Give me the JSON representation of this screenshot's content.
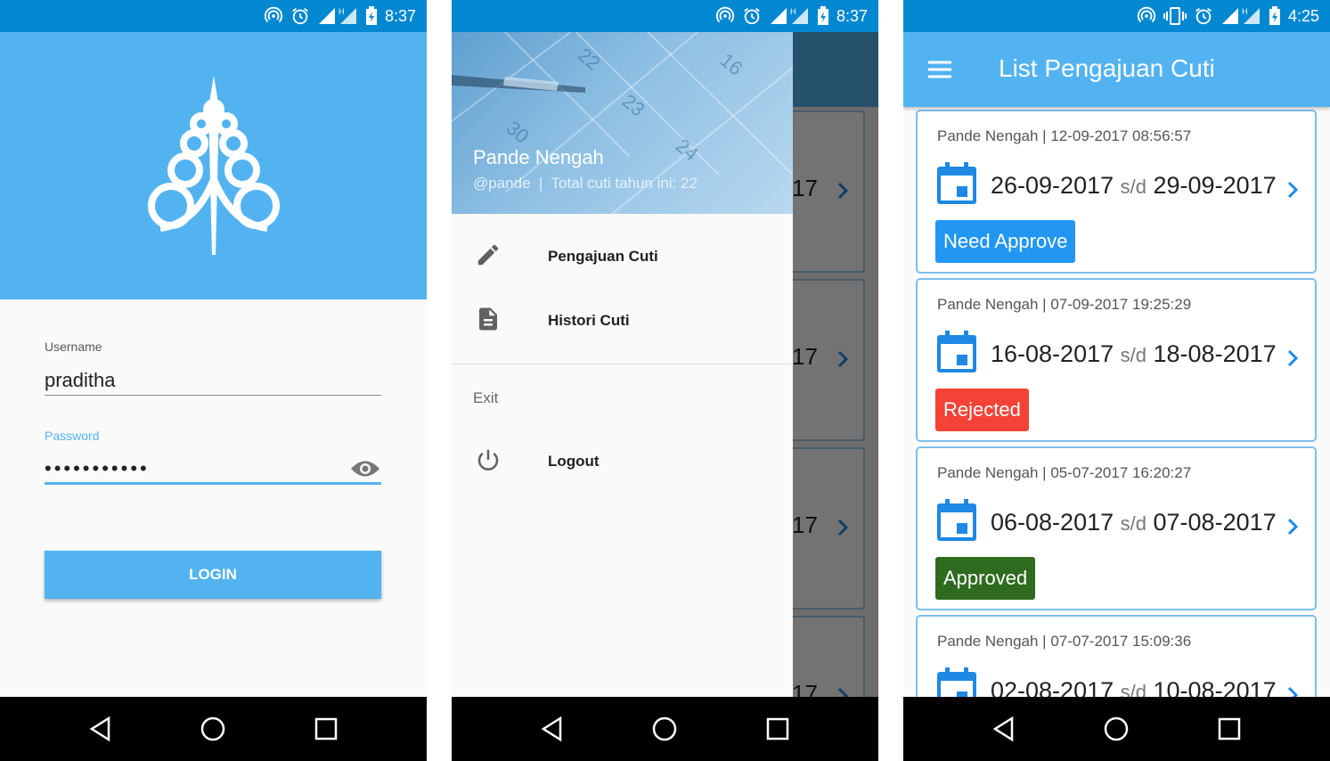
{
  "status_bar_1": {
    "time": "8:37"
  },
  "status_bar_2": {
    "time": "8:37"
  },
  "status_bar_3": {
    "time": "4:25"
  },
  "login": {
    "username_label": "Username",
    "username_value": "praditha",
    "password_label": "Password",
    "password_value": "•••••••••••",
    "login_label": "LOGIN"
  },
  "drawer": {
    "name": "Pande Nengah",
    "subtitle": "@pande  |  Total cuti tahun ini: 22",
    "items": [
      {
        "label": "Pengajuan Cuti",
        "icon": "pencil-icon"
      },
      {
        "label": "Histori Cuti",
        "icon": "document-icon"
      }
    ],
    "section_label": "Exit",
    "logout_label": "Logout",
    "behind_text": "17"
  },
  "list": {
    "title": "List Pengajuan Cuti",
    "separator": "s/d",
    "cards": [
      {
        "name": "Pande Nengah",
        "timestamp": "12-09-2017 08:56:57",
        "from": "26-09-2017",
        "to": "29-09-2017",
        "status": "Need Approve",
        "status_color": "#2196f3"
      },
      {
        "name": "Pande Nengah",
        "timestamp": "07-09-2017 19:25:29",
        "from": "16-08-2017",
        "to": "18-08-2017",
        "status": "Rejected",
        "status_color": "#f44336"
      },
      {
        "name": "Pande Nengah",
        "timestamp": "05-07-2017 16:20:27",
        "from": "06-08-2017",
        "to": "07-08-2017",
        "status": "Approved",
        "status_color": "#2e6b1f"
      },
      {
        "name": "Pande Nengah",
        "timestamp": "07-07-2017 15:09:36",
        "from": "02-08-2017",
        "to": "10-08-2017",
        "status": "",
        "status_color": "#2196f3"
      }
    ]
  },
  "colors": {
    "status_bar": "#0288d1",
    "primary": "#52b3f0",
    "accent_icon": "#1e88e5"
  }
}
